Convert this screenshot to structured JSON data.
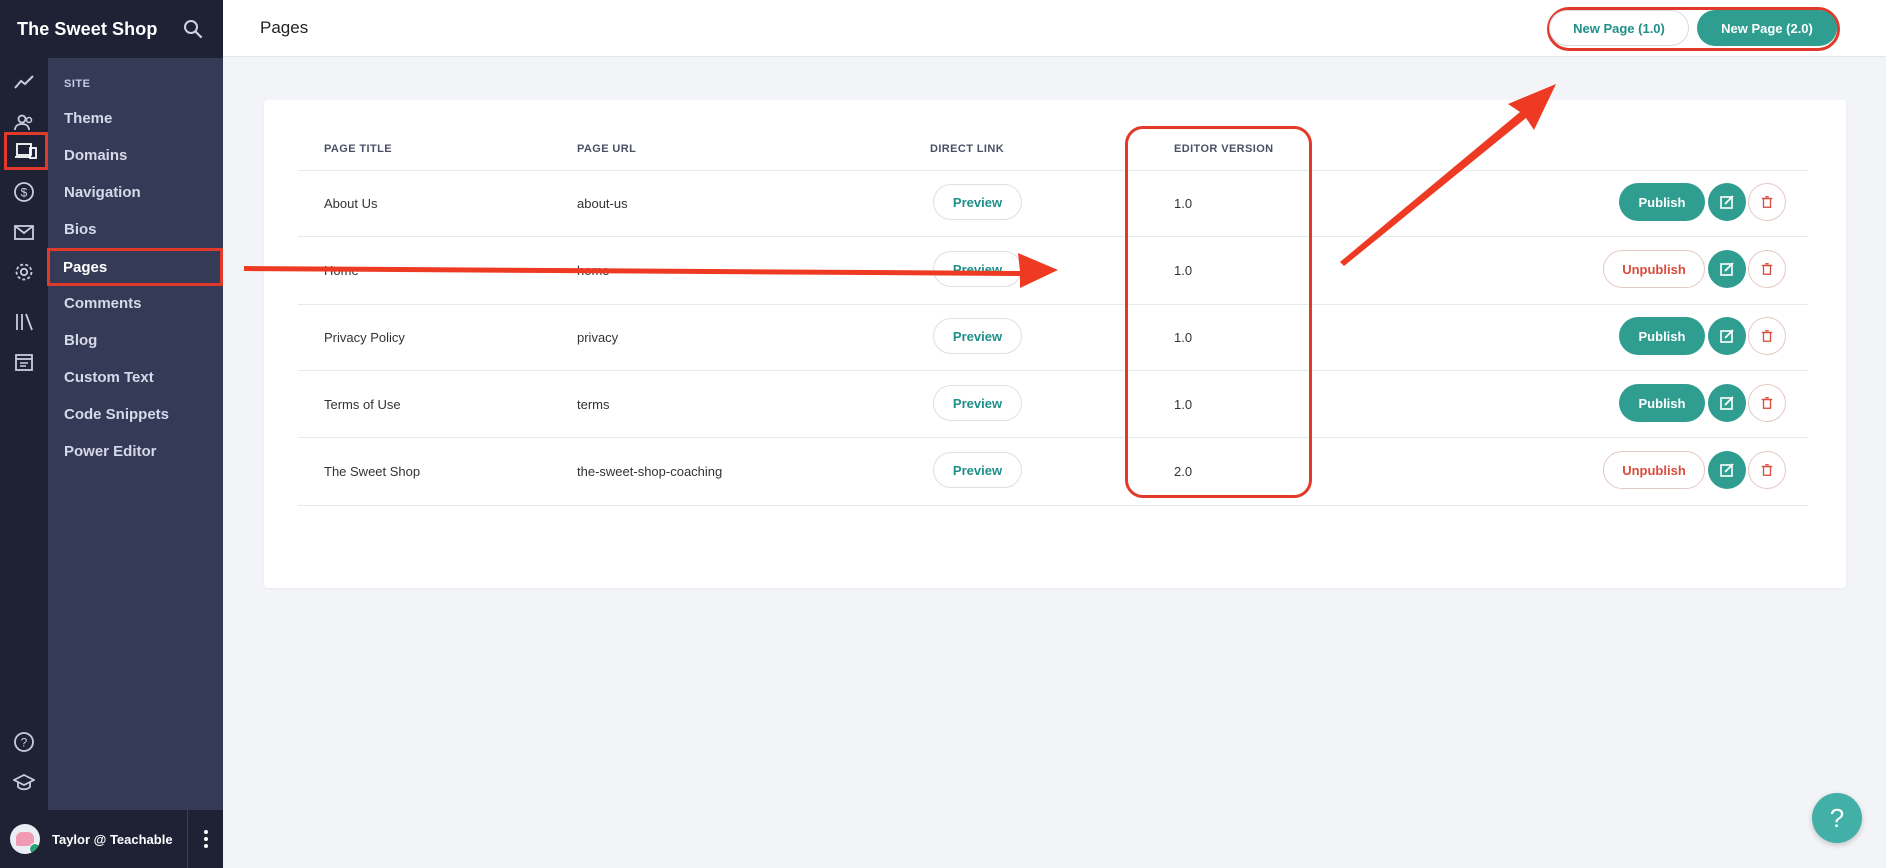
{
  "brand": {
    "title": "The Sweet Shop",
    "search_icon": "search-icon"
  },
  "rail": {
    "icons": [
      "analytics-icon",
      "users-icon",
      "site-icon",
      "sales-icon",
      "email-icon",
      "settings-icon",
      "library-icon",
      "calendar-icon",
      "help-icon",
      "school-icon"
    ],
    "active": "site-icon"
  },
  "submenu": {
    "heading": "SITE",
    "items": [
      {
        "label": "Theme"
      },
      {
        "label": "Domains"
      },
      {
        "label": "Navigation"
      },
      {
        "label": "Bios"
      },
      {
        "label": "Pages"
      },
      {
        "label": "Comments"
      },
      {
        "label": "Blog"
      },
      {
        "label": "Custom Text"
      },
      {
        "label": "Code Snippets"
      },
      {
        "label": "Power Editor"
      }
    ],
    "active": "Pages"
  },
  "user": {
    "name": "Taylor @ Teachable"
  },
  "header": {
    "title": "Pages",
    "new_page_1": "New Page (1.0)",
    "new_page_2": "New Page (2.0)"
  },
  "table": {
    "headers": {
      "title": "PAGE TITLE",
      "url": "PAGE URL",
      "link": "DIRECT LINK",
      "version": "EDITOR VERSION"
    },
    "preview_label": "Preview",
    "rows": [
      {
        "title": "About Us",
        "url": "about-us",
        "version": "1.0",
        "action": "Publish"
      },
      {
        "title": "Home",
        "url": "home",
        "version": "1.0",
        "action": "Unpublish"
      },
      {
        "title": "Privacy Policy",
        "url": "privacy",
        "version": "1.0",
        "action": "Publish"
      },
      {
        "title": "Terms of Use",
        "url": "terms",
        "version": "1.0",
        "action": "Publish"
      },
      {
        "title": "The Sweet Shop",
        "url": "the-sweet-shop-coaching",
        "version": "2.0",
        "action": "Unpublish"
      }
    ]
  },
  "help": {
    "label": "?"
  },
  "colors": {
    "accent": "#2f9e91",
    "annotation": "#e13a2b",
    "sidebar_dark": "#1f2235",
    "sidebar_panel": "#353a56"
  }
}
